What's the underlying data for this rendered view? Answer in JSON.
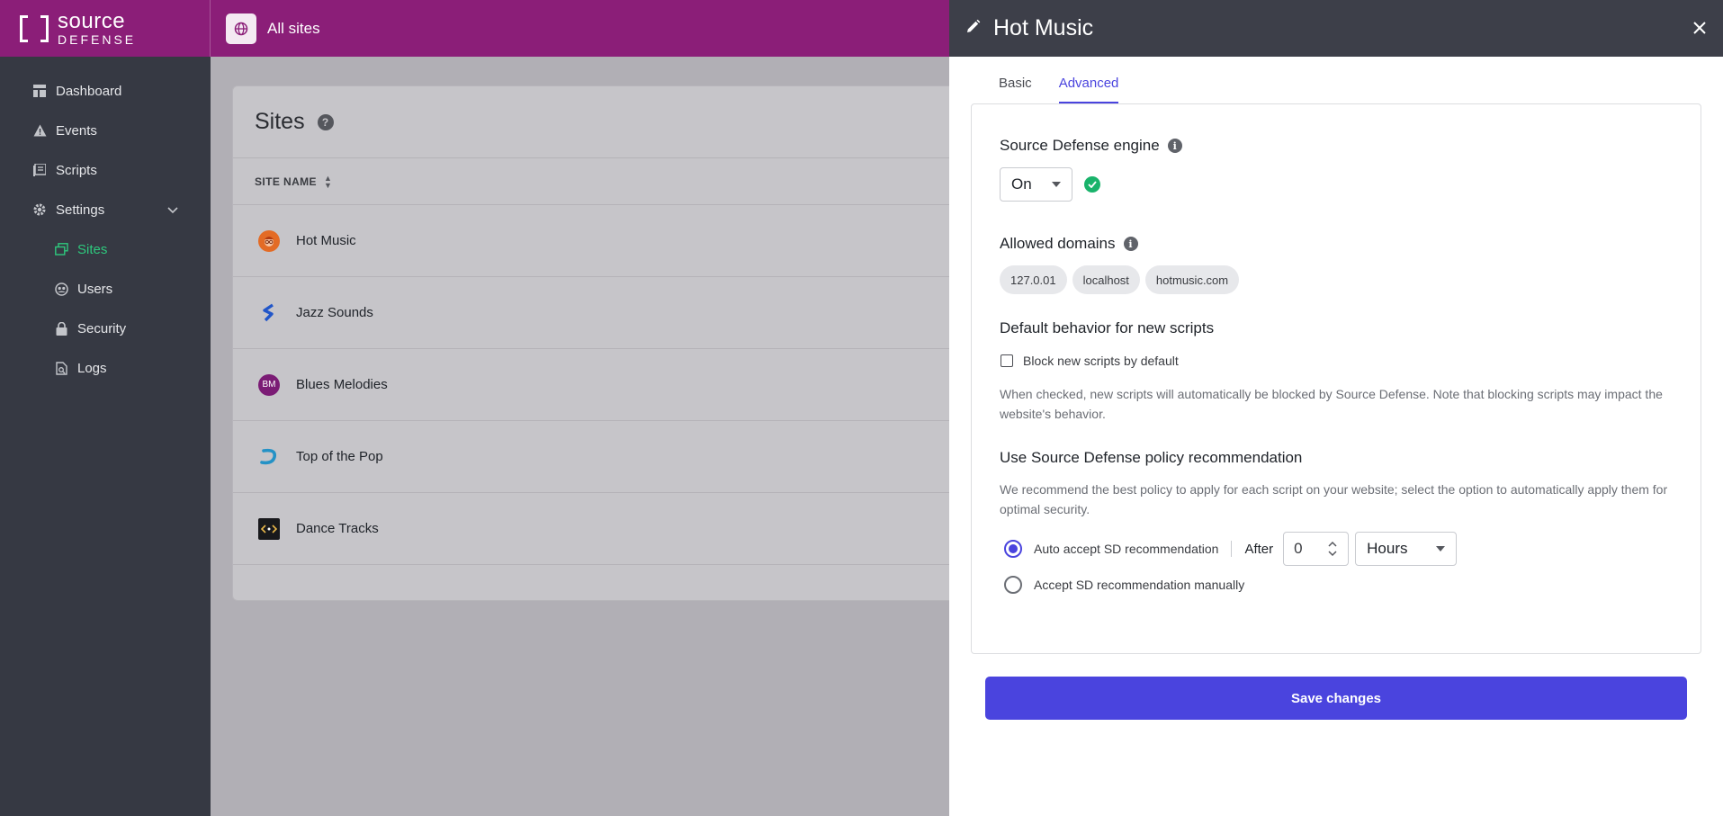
{
  "brand": {
    "line1": "source",
    "line2": "DEFENSE"
  },
  "header": {
    "site_switch_label": "All sites"
  },
  "sidebar": {
    "items": [
      {
        "label": "Dashboard"
      },
      {
        "label": "Events"
      },
      {
        "label": "Scripts"
      },
      {
        "label": "Settings"
      },
      {
        "label": "Sites"
      },
      {
        "label": "Users"
      },
      {
        "label": "Security"
      },
      {
        "label": "Logs"
      }
    ]
  },
  "sites_page": {
    "title": "Sites",
    "column_header": "SITE NAME",
    "rows": [
      {
        "name": "Hot Music"
      },
      {
        "name": "Jazz Sounds"
      },
      {
        "name": "Blues Melodies",
        "avatar_text": "BM"
      },
      {
        "name": "Top of the Pop"
      },
      {
        "name": "Dance Tracks"
      }
    ]
  },
  "drawer": {
    "title": "Hot Music",
    "tabs": [
      {
        "label": "Basic"
      },
      {
        "label": "Advanced",
        "active": true
      }
    ],
    "engine": {
      "title": "Source Defense engine",
      "value": "On"
    },
    "domains": {
      "title": "Allowed domains",
      "chips": [
        "127.0.01",
        "localhost",
        "hotmusic.com"
      ]
    },
    "default_behavior": {
      "title": "Default behavior for new scripts",
      "checkbox_label": "Block new scripts by default",
      "checked": false,
      "hint": "When checked, new scripts will automatically be blocked by Source Defense. Note that blocking scripts may impact the website's behavior."
    },
    "policy": {
      "title": "Use Source Defense policy recommendation",
      "hint": "We recommend the best policy to apply for each script on your website; select the option to automatically apply them for optimal security.",
      "auto_label": "Auto accept SD recommendation",
      "after_label": "After",
      "after_value": "0",
      "unit": "Hours",
      "manual_label": "Accept SD recommendation manually"
    },
    "save_label": "Save changes"
  },
  "colors": {
    "accent": "#4a44de",
    "topbar": "#8b1e78",
    "sidebar": "#363943",
    "success": "#19b36b"
  }
}
